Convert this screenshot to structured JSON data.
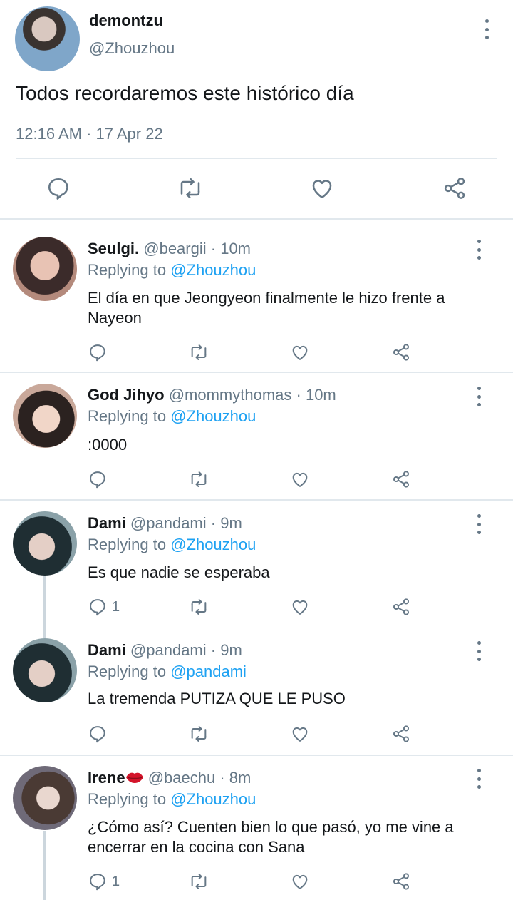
{
  "main_tweet": {
    "name": "demontzu",
    "handle": "@Zhouzhou",
    "text": "Todos recordaremos este histórico día",
    "meta": "12:16 AM · 17 Apr 22"
  },
  "replies": [
    {
      "name": "Seulgi.",
      "handle": "@beargii",
      "sep": " · ",
      "time": "10m",
      "replying_prefix": "Replying to ",
      "replying_to": "@Zhouzhou",
      "text": "El día en que Jeongyeon finalmente le hizo frente a Nayeon",
      "reply_count": ""
    },
    {
      "name": "God Jihyo",
      "handle": "@mommythomas",
      "sep": " · ",
      "time": "10m",
      "replying_prefix": "Replying to ",
      "replying_to": "@Zhouzhou",
      "text": ":0000",
      "reply_count": ""
    },
    {
      "name": "Dami",
      "handle": "@pandami",
      "sep": " · ",
      "time": "9m",
      "replying_prefix": "Replying to ",
      "replying_to": "@Zhouzhou",
      "text": "Es que nadie se esperaba",
      "reply_count": "1"
    },
    {
      "name": "Dami",
      "handle": "@pandami",
      "sep": " · ",
      "time": "9m",
      "replying_prefix": "Replying to ",
      "replying_to": "@pandami",
      "text": "La tremenda PUTIZA QUE LE PUSO",
      "reply_count": ""
    },
    {
      "name": "Irene",
      "handle": "@baechu",
      "sep": " · ",
      "time": "8m",
      "replying_prefix": "Replying to ",
      "replying_to": "@Zhouzhou",
      "text": "¿Cómo así? Cuenten bien lo que pasó, yo me vine a encerrar en la cocina con Sana",
      "reply_count": "1"
    }
  ],
  "icons": {
    "reply": "speech-bubble-icon",
    "retweet": "retweet-icon",
    "like": "heart-icon",
    "share": "share-icon",
    "more": "more-vertical-icon",
    "name_emoji": "kiss-lips-emoji"
  },
  "colors": {
    "link": "#1da1f2",
    "secondary_text": "#657786",
    "divider": "#e1e8ed"
  }
}
